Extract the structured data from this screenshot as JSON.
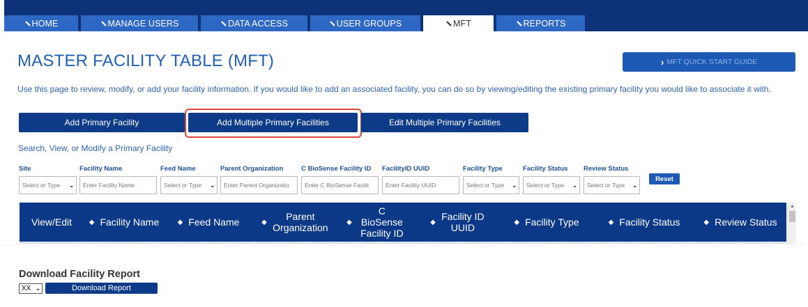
{
  "nav": {
    "tabs": [
      {
        "label": "HOME"
      },
      {
        "label": "MANAGE USERS"
      },
      {
        "label": "DATA ACCESS"
      },
      {
        "label": "USER GROUPS"
      },
      {
        "label": "MFT"
      },
      {
        "label": "REPORTS"
      }
    ],
    "active_tab": "MFT"
  },
  "page": {
    "title": "MASTER FACILITY TABLE (MFT)",
    "quick_start_label": "MFT QUICK START GUIDE",
    "intro": "Use this page to review, modify, or add your facility information. If you would like to add an associated facility, you can do so by viewing/editing the existing primary facility you would like to associate it with."
  },
  "actions": {
    "add_primary": "Add Primary Facility",
    "add_multiple": "Add Multiple Primary Facilities",
    "edit_multiple": "Edit Multiple Primary Facilities"
  },
  "search": {
    "heading": "Search, View, or Modify a Primary Facility",
    "filters": [
      {
        "label": "Site",
        "kind": "select",
        "value": "Select or Type"
      },
      {
        "label": "Facility Name",
        "kind": "input",
        "placeholder": "Enter Facility Name"
      },
      {
        "label": "Feed Name",
        "kind": "select",
        "value": "Select or Type"
      },
      {
        "label": "Parent Organization",
        "kind": "input",
        "placeholder": "Enter Parent Organizatio"
      },
      {
        "label": "C BioSense Facility ID",
        "kind": "input",
        "placeholder": "Enter C BioSense Facilit"
      },
      {
        "label": "FacilityID UUID",
        "kind": "input",
        "placeholder": "Enter Facility UUID"
      },
      {
        "label": "Facility Type",
        "kind": "select",
        "value": "Select or Type"
      },
      {
        "label": "Facility Status",
        "kind": "select",
        "value": "Select or Type"
      },
      {
        "label": "Review Status",
        "kind": "select",
        "value": "Select or Type"
      }
    ],
    "reset_label": "Reset"
  },
  "table": {
    "columns": [
      {
        "label": "View/Edit",
        "sortable": false
      },
      {
        "label": "Facility Name",
        "sortable": true
      },
      {
        "label": "Feed Name",
        "sortable": true
      },
      {
        "label": "Parent Organization",
        "sortable": true
      },
      {
        "label": "C BioSense Facility ID",
        "sortable": true
      },
      {
        "label": "Facility ID UUID",
        "sortable": true
      },
      {
        "label": "Facility Type",
        "sortable": true
      },
      {
        "label": "Facility Status",
        "sortable": true
      },
      {
        "label": "Review Status",
        "sortable": true
      }
    ]
  },
  "download": {
    "heading": "Download Facility Report",
    "format_value": "XX",
    "button_label": "Download Report"
  },
  "colors": {
    "nav_bar": "#0d3278",
    "nav_tab": "#2d68c4",
    "primary_button": "#0e3b88",
    "link_text": "#2f63b6",
    "highlight": "#d7453b",
    "table_header": "#0b3987"
  }
}
